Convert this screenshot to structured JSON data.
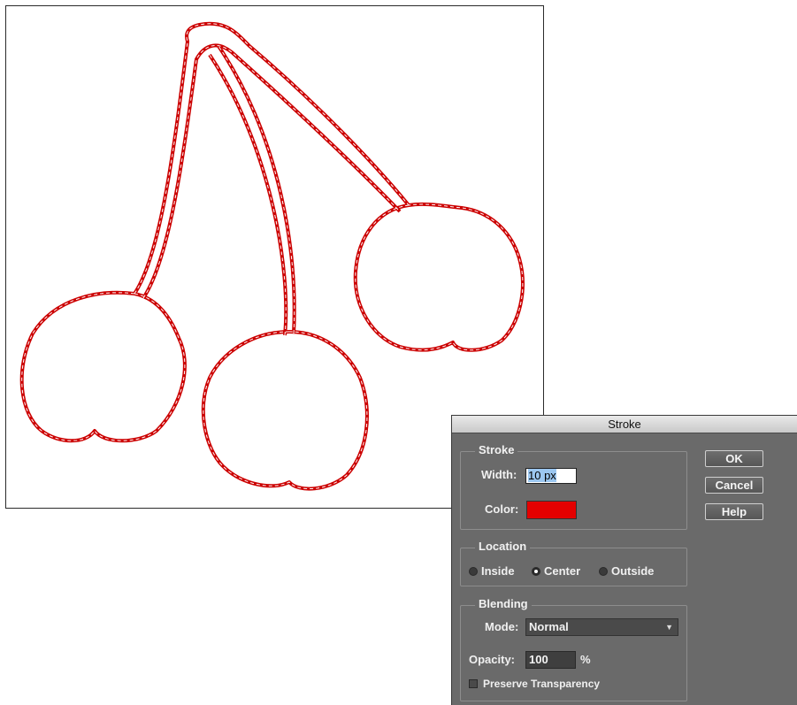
{
  "dialog": {
    "title": "Stroke",
    "stroke_group": {
      "label": "Stroke",
      "width_label": "Width:",
      "width_value": "10 px",
      "color_label": "Color:",
      "color_value": "#e40000"
    },
    "location_group": {
      "label": "Location",
      "options": [
        "Inside",
        "Center",
        "Outside"
      ],
      "selected": "Center"
    },
    "blending_group": {
      "label": "Blending",
      "mode_label": "Mode:",
      "mode_value": "Normal",
      "opacity_label": "Opacity:",
      "opacity_value": "100",
      "opacity_unit": "%",
      "preserve_transparency_label": "Preserve Transparency",
      "preserve_transparency_checked": false
    },
    "buttons": {
      "ok": "OK",
      "cancel": "Cancel",
      "help": "Help"
    }
  },
  "canvas": {
    "stroke_color": "#cc0000",
    "selection_color": "#ffffff",
    "background": "#ffffff"
  }
}
